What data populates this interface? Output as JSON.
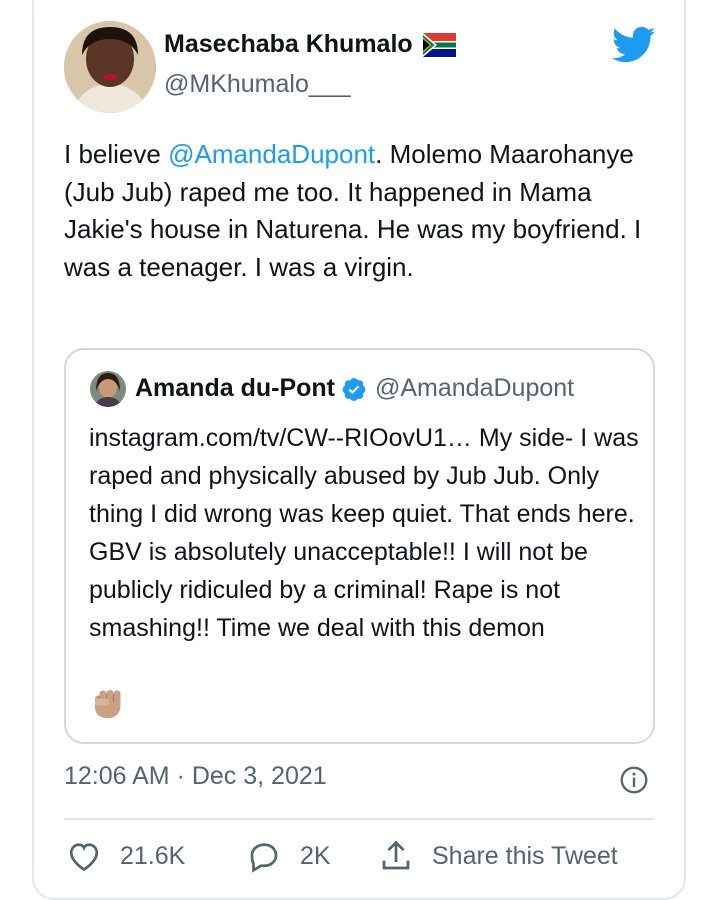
{
  "tweet": {
    "author_name": "Masechaba Khumalo",
    "author_handle": "@MKhumalo___",
    "text_prefix": "I believe ",
    "mention": "@AmandaDupont",
    "text_suffix": ". Molemo Maarohanye (Jub Jub) raped me too. It happened in Mama Jakie's house in Naturena. He was my boyfriend. I was a teenager. I was a virgin.",
    "timestamp": "12:06 AM · Dec 3, 2021"
  },
  "quoted_tweet": {
    "author_name": "Amanda du-Pont",
    "author_handle": "@AmandaDupont",
    "text": "instagram.com/tv/CW--RIOovU1… My side- I was raped and physically abused by Jub Jub. Only thing I did wrong was keep quiet. That ends here. GBV is absolutely unacceptable!! I will not be publicly ridiculed by a criminal! Rape is not smashing!! Time we deal with this demon"
  },
  "actions": {
    "likes": "21.6K",
    "replies": "2K",
    "share_label": "Share this Tweet"
  },
  "icons": {
    "brand": "twitter-bird-icon",
    "verified": "verified-badge-icon",
    "info": "info-icon",
    "like": "heart-icon",
    "reply": "reply-bubble-icon",
    "share": "share-icon",
    "emoji": "raised-fist-icon",
    "flag": "south-africa-flag-icon"
  },
  "colors": {
    "brand_blue": "#1d9bf0",
    "text_primary": "#0f1419",
    "text_secondary": "#536471",
    "border": "#cfd9de"
  }
}
